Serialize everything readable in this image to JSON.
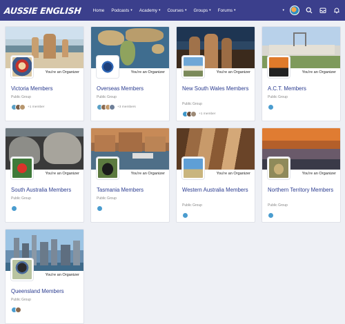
{
  "brand": {
    "logo": "AUSSIE ENGLISH"
  },
  "nav": [
    {
      "label": "Home",
      "dropdown": false
    },
    {
      "label": "Podcasts",
      "dropdown": true
    },
    {
      "label": "Academy",
      "dropdown": true
    },
    {
      "label": "Courses",
      "dropdown": true
    },
    {
      "label": "Groups",
      "dropdown": true
    },
    {
      "label": "Forums",
      "dropdown": true
    }
  ],
  "toolbar": {
    "icons": [
      "search-icon",
      "inbox-icon",
      "bell-icon"
    ]
  },
  "groups": [
    {
      "name": "Victoria Members",
      "role": "You're an Organizer",
      "type": "Public Group",
      "member_count": "+1 member"
    },
    {
      "name": "Overseas Members",
      "role": "You're an Organizer",
      "type": "Public Group",
      "member_count": "+3 members"
    },
    {
      "name": "New South Wales Members",
      "role": "You're an Organizer",
      "type": "Public Group",
      "member_count": "+1 member"
    },
    {
      "name": "A.C.T. Members",
      "role": "You're an Organizer",
      "type": "Public Group",
      "member_count": ""
    },
    {
      "name": "South Australia Members",
      "role": "You're an Organizer",
      "type": "Public Group",
      "member_count": ""
    },
    {
      "name": "Tasmania Members",
      "role": "You're an Organizer",
      "type": "Public Group",
      "member_count": ""
    },
    {
      "name": "Western Australia Members",
      "role": "You're an Organizer",
      "type": "Public Group",
      "member_count": ""
    },
    {
      "name": "Northern Territory Members",
      "role": "You're an Organizer",
      "type": "Public Group",
      "member_count": ""
    },
    {
      "name": "Queensland Members",
      "role": "You're an Organizer",
      "type": "Public Group",
      "member_count": ""
    }
  ]
}
